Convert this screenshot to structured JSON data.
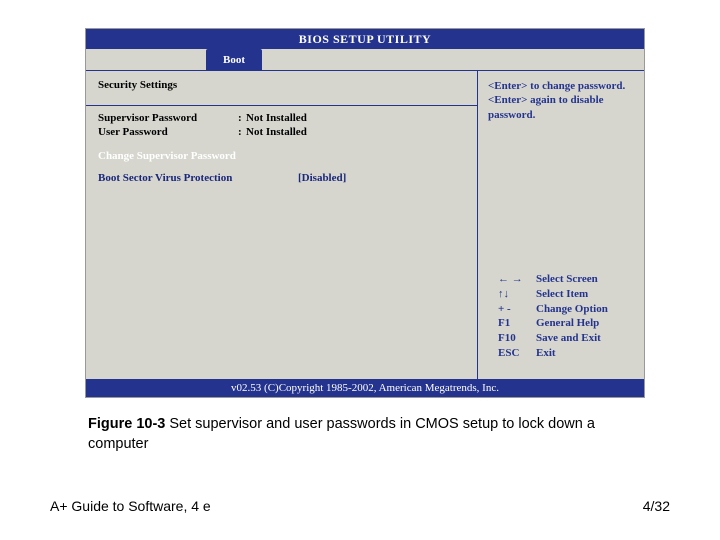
{
  "bios": {
    "title": "BIOS SETUP UTILITY",
    "tab": "Boot",
    "section_heading": "Security Settings",
    "rows": [
      {
        "label": "Supervisor Password",
        "value": "Not Installed"
      },
      {
        "label": "User Password",
        "value": "Not Installed"
      }
    ],
    "highlighted": "Change Supervisor Password",
    "boot_row": {
      "label": "Boot Sector Virus Protection",
      "value": "[Disabled]"
    },
    "help_upper": [
      "<Enter> to change password.",
      "<Enter> again to disable password."
    ],
    "keys": [
      {
        "key": "← →",
        "action": "Select Screen"
      },
      {
        "key": "↑↓",
        "action": "Select Item"
      },
      {
        "key": "+ -",
        "action": "Change Option"
      },
      {
        "key": "F1",
        "action": "General Help"
      },
      {
        "key": "F10",
        "action": "Save and Exit"
      },
      {
        "key": "ESC",
        "action": "Exit"
      }
    ],
    "copyright": "v02.53 (C)Copyright 1985-2002, American Megatrends, Inc."
  },
  "caption": {
    "label": "Figure 10-3",
    "text": " Set supervisor and user passwords in CMOS setup to lock down a computer"
  },
  "footer": {
    "left": "A+ Guide to Software, 4 e",
    "right": "4/32"
  }
}
